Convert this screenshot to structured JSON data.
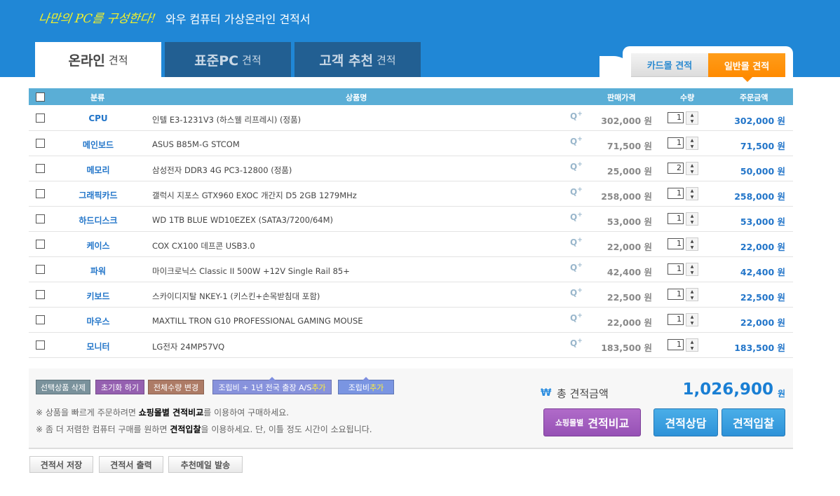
{
  "header": {
    "slogan": "나만의 PC를 구성한다!",
    "title": "와우 컴퓨터 가상온라인 견적서"
  },
  "tabs": [
    {
      "main": "온라인",
      "sub": "견적"
    },
    {
      "main": "표준PC",
      "sub": "견적"
    },
    {
      "main": "고객 추천",
      "sub": "견적"
    }
  ],
  "mall_tabs": {
    "card": "카드몰 견적",
    "general": "일반몰 견적"
  },
  "columns": {
    "category": "분류",
    "name": "상품명",
    "price": "판매가격",
    "qty": "수량",
    "total": "주문금액"
  },
  "rows": [
    {
      "category": "CPU",
      "name": "인텔 E3-1231V3 (하스웰 리프레시) (정품)",
      "price": "302,000 원",
      "qty": "1",
      "total": "302,000 원"
    },
    {
      "category": "메인보드",
      "name": "ASUS B85M-G STCOM",
      "price": "71,500 원",
      "qty": "1",
      "total": "71,500 원"
    },
    {
      "category": "메모리",
      "name": "삼성전자 DDR3 4G PC3-12800 (정품)",
      "price": "25,000 원",
      "qty": "2",
      "total": "50,000 원"
    },
    {
      "category": "그래픽카드",
      "name": "갤럭시 지포스 GTX960 EXOC 개간지 D5 2GB 1279MHz",
      "price": "258,000 원",
      "qty": "1",
      "total": "258,000 원"
    },
    {
      "category": "하드디스크",
      "name": "WD 1TB BLUE WD10EZEX (SATA3/7200/64M)",
      "price": "53,000 원",
      "qty": "1",
      "total": "53,000 원"
    },
    {
      "category": "케이스",
      "name": "COX CX100 데프콘 USB3.0",
      "price": "22,000 원",
      "qty": "1",
      "total": "22,000 원"
    },
    {
      "category": "파워",
      "name": "마이크로닉스 Classic II 500W +12V Single Rail 85+",
      "price": "42,400 원",
      "qty": "1",
      "total": "42,400 원"
    },
    {
      "category": "키보드",
      "name": "스카이디지탈 NKEY-1 (키스킨+손목받침대 포함)",
      "price": "22,500 원",
      "qty": "1",
      "total": "22,500 원"
    },
    {
      "category": "마우스",
      "name": "MAXTILL TRON G10 PROFESSIONAL GAMING MOUSE",
      "price": "22,000 원",
      "qty": "1",
      "total": "22,000 원"
    },
    {
      "category": "모니터",
      "name": "LG전자 24MP57VQ",
      "price": "183,500 원",
      "qty": "1",
      "total": "183,500 원"
    }
  ],
  "zoom_label": "Q",
  "actions": {
    "delete": "선택상품 삭제",
    "reset": "초기화 하기",
    "change_qty": "전체수량 변경",
    "assembly_as": "조립비 + 1년 전국 출장 A/S ",
    "assembly": "조립비 ",
    "add": "추가"
  },
  "notes": [
    {
      "pre": "※ 상품을 빠르게 주문하려면 ",
      "bold": "쇼핑몰별 견적비교",
      "post": "를 이용하여 구매하세요."
    },
    {
      "pre": "※ 좀 더 저렴한 컴퓨터 구매를 원하면 ",
      "bold": "견적입찰",
      "post": "을 이용하세요. 단, 이틀 정도 시간이 소요됩니다."
    }
  ],
  "summary": {
    "currency_symbol": "₩",
    "label": "총 견적금액",
    "value": "1,026,900",
    "unit": "원"
  },
  "buttons": {
    "compare_small": "쇼핑몰별",
    "compare": "견적비교",
    "consult": "견적상담",
    "bid": "견적입찰"
  },
  "footer": {
    "save": "견적서 저장",
    "print": "견적서 출력",
    "mail": "추천메일 발송"
  }
}
